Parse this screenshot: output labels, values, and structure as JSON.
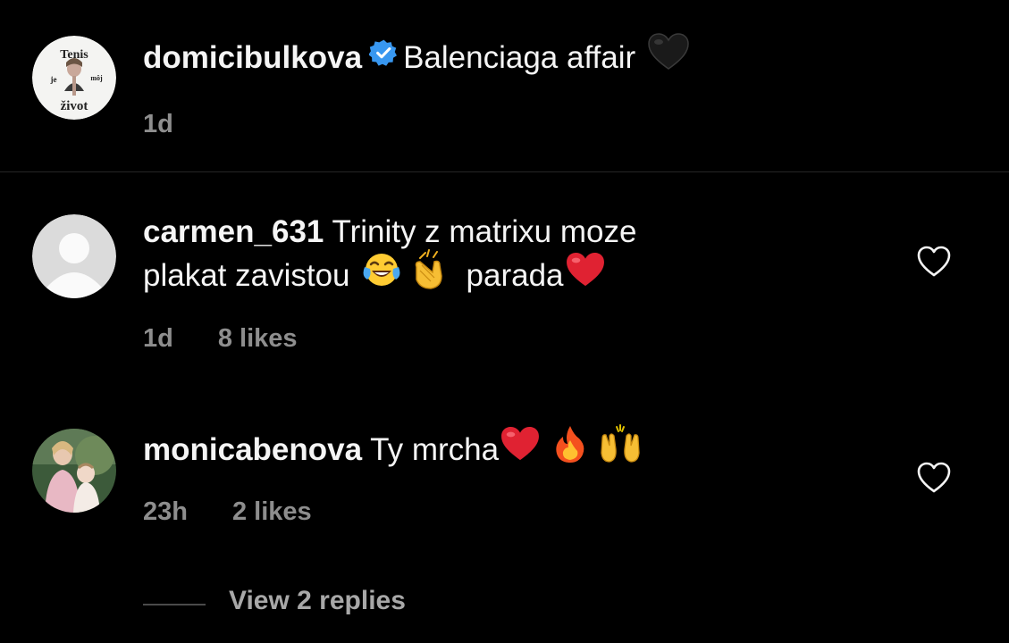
{
  "post": {
    "username": "domicibulkova",
    "caption": "Balenciaga affair",
    "caption_emoji": "black-heart",
    "time": "1d",
    "verified": true,
    "avatar_text": [
      "Tenis",
      "je",
      "môj",
      "život"
    ]
  },
  "comments": [
    {
      "username": "carmen_631",
      "text_line1": "Trinity z matrixu moze",
      "text_line2_a": "plakat zavistou",
      "text_line2_b": "parada",
      "emojis": [
        "face-with-tears-of-joy",
        "clapping-hands",
        "red-heart"
      ],
      "time": "1d",
      "likes": "8 likes"
    },
    {
      "username": "monicabenova",
      "text": "Ty mrcha",
      "emojis": [
        "red-heart",
        "fire",
        "raising-hands"
      ],
      "time": "23h",
      "likes": "2 likes"
    }
  ],
  "view_replies": "View 2 replies",
  "colors": {
    "background": "#000000",
    "text": "#f5f5f5",
    "secondary": "#8e8e8e",
    "verified": "#3897f0",
    "divider": "#262626"
  }
}
